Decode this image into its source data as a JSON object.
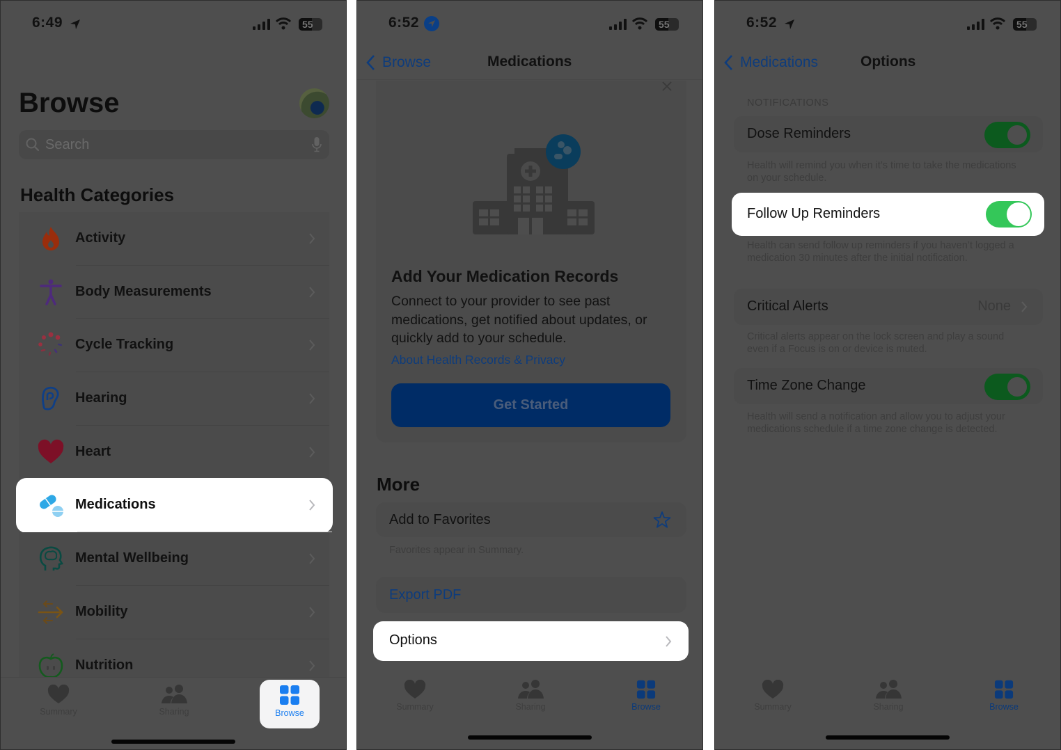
{
  "panel1": {
    "status": {
      "time": "6:49",
      "battery": "55"
    },
    "title": "Browse",
    "search": {
      "placeholder": "Search"
    },
    "section_title": "Health Categories",
    "categories": [
      {
        "label": "Activity",
        "icon": "flame-icon",
        "color": "#c5340c"
      },
      {
        "label": "Body Measurements",
        "icon": "figure-icon",
        "color": "#6a3aa8"
      },
      {
        "label": "Cycle Tracking",
        "icon": "cycle-dots-icon",
        "color": "#d24a5c"
      },
      {
        "label": "Hearing",
        "icon": "ear-icon",
        "color": "#1a6ad6"
      },
      {
        "label": "Heart",
        "icon": "heart-icon",
        "color": "#c0183c"
      },
      {
        "label": "Medications",
        "icon": "pills-icon",
        "color": "#2ea8e6",
        "highlighted": true
      },
      {
        "label": "Mental Wellbeing",
        "icon": "brain-head-icon",
        "color": "#1a8a7c"
      },
      {
        "label": "Mobility",
        "icon": "arrows-icon",
        "color": "#e0a23a"
      },
      {
        "label": "Nutrition",
        "icon": "apple-icon",
        "color": "#2fae3f"
      }
    ],
    "tabs": [
      {
        "label": "Summary",
        "icon": "heart-icon"
      },
      {
        "label": "Sharing",
        "icon": "people-icon"
      },
      {
        "label": "Browse",
        "icon": "grid-icon",
        "active": true
      }
    ]
  },
  "panel2": {
    "status": {
      "time": "6:52",
      "battery": "55"
    },
    "nav": {
      "back": "Browse",
      "title": "Medications"
    },
    "card": {
      "title": "Add Your Medication Records",
      "description": "Connect to your provider to see past medications, get notified about updates, or quickly add to your schedule.",
      "link": "About Health Records & Privacy",
      "button": "Get Started"
    },
    "more_title": "More",
    "add_favorites": "Add to Favorites",
    "favorites_note": "Favorites appear in Summary.",
    "export_pdf": "Export PDF",
    "options": "Options",
    "tabs": [
      {
        "label": "Summary"
      },
      {
        "label": "Sharing"
      },
      {
        "label": "Browse",
        "active": true
      }
    ]
  },
  "panel3": {
    "status": {
      "time": "6:52",
      "battery": "55"
    },
    "nav": {
      "back": "Medications",
      "title": "Options"
    },
    "section_header": "NOTIFICATIONS",
    "rows": [
      {
        "label": "Dose Reminders",
        "type": "toggle",
        "on": true,
        "note": "Health will remind you when it’s time to take the medications on your schedule."
      },
      {
        "label": "Follow Up Reminders",
        "type": "toggle",
        "on": true,
        "highlighted": true,
        "note": "Health can send follow up reminders if you haven’t logged a medication 30 minutes after the initial notification."
      },
      {
        "label": "Critical Alerts",
        "type": "value",
        "value": "None",
        "note": "Critical alerts appear on the lock screen and play a sound even if a Focus is on or device is muted."
      },
      {
        "label": "Time Zone Change",
        "type": "toggle",
        "on": true,
        "note": "Health will send a notification and allow you to adjust your medications schedule if a time zone change is detected."
      }
    ],
    "tabs": [
      {
        "label": "Summary"
      },
      {
        "label": "Sharing"
      },
      {
        "label": "Browse",
        "active": true
      }
    ]
  },
  "colors": {
    "accent_blue": "#1a7ef0",
    "toggle_green": "#34c759",
    "dim_overlay": "#4e4e4e"
  }
}
